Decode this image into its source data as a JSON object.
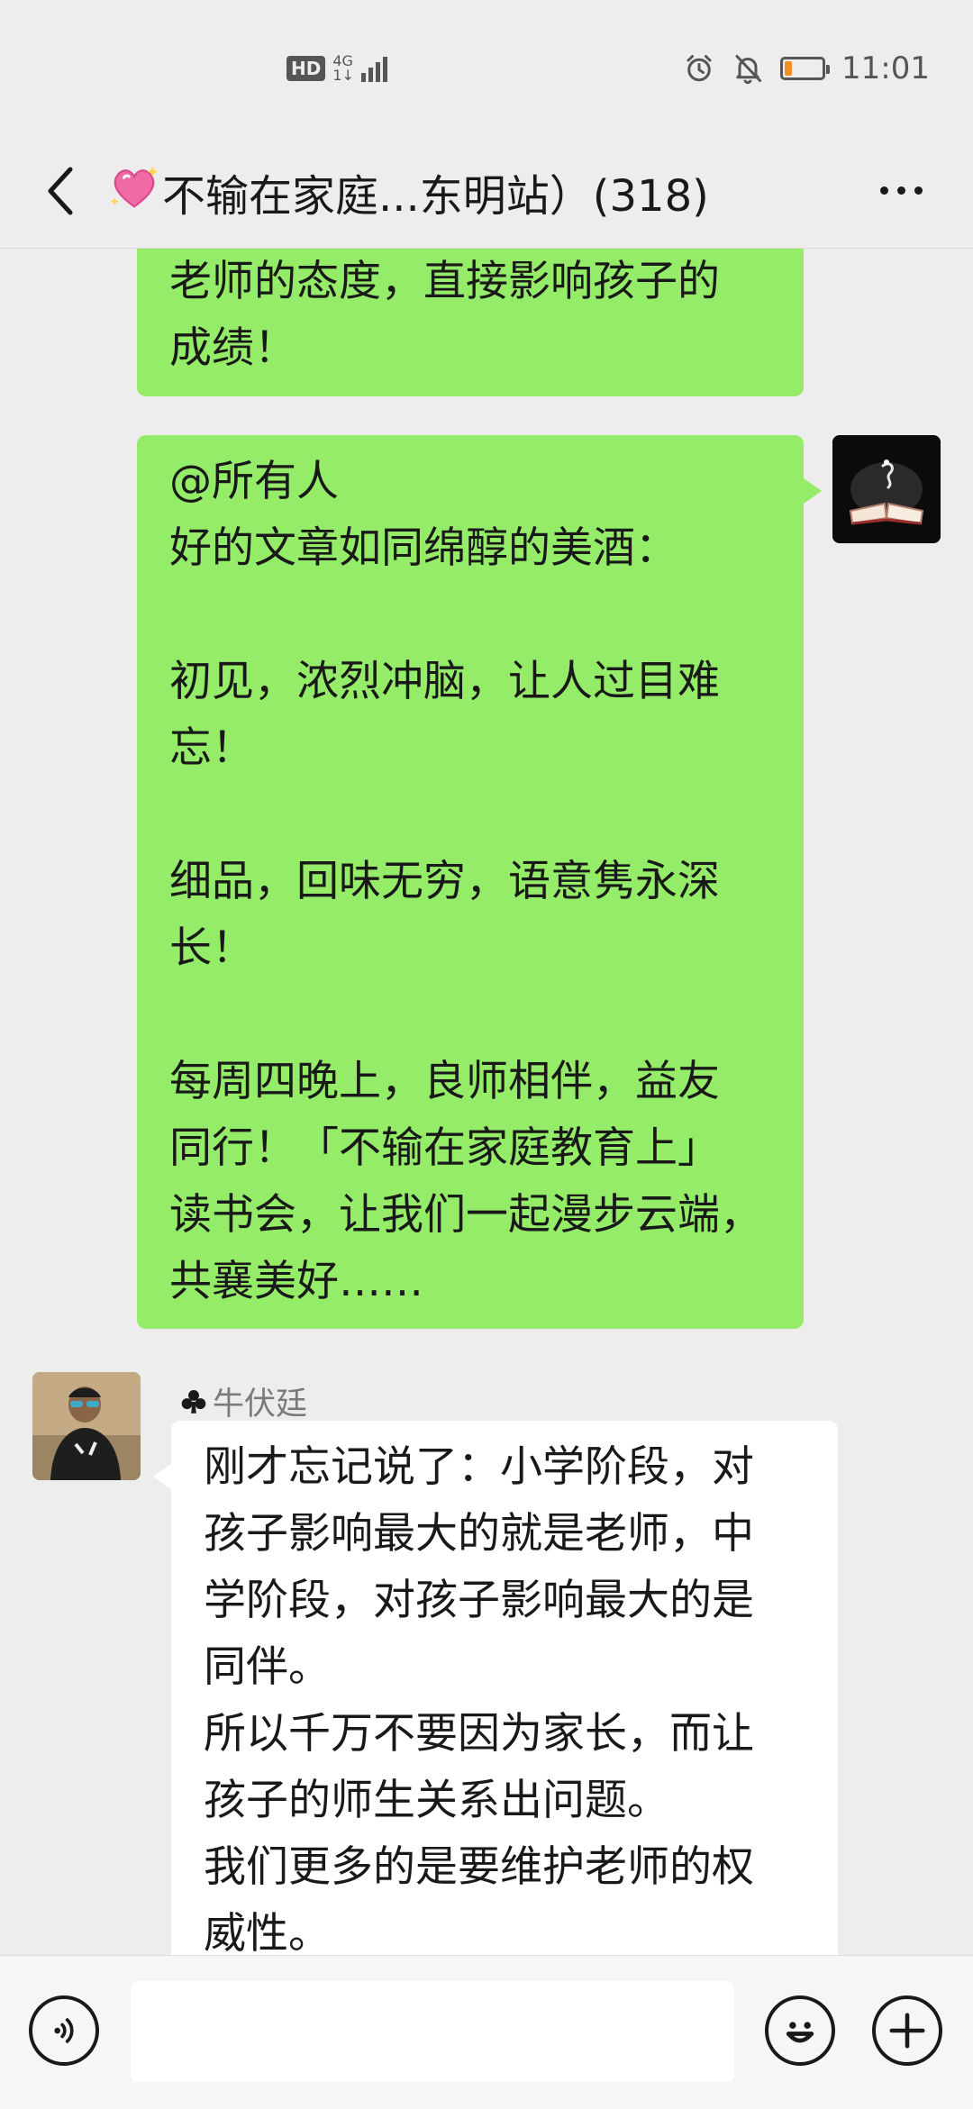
{
  "status_bar": {
    "hd": "HD",
    "network": "4G",
    "network_sub": "1↓",
    "time": "11:01",
    "battery_level": 0.2,
    "icons": [
      "alarm-icon",
      "mute-icon",
      "battery-icon"
    ]
  },
  "nav": {
    "title": "不输在家庭...东明站）(318)",
    "title_icon": "sparkling-heart-icon",
    "back_icon": "chevron-left-icon",
    "more_icon": "more-dots-icon"
  },
  "messages": [
    {
      "side": "right",
      "text": "老师的态度，直接影响孩子的\n成绩！"
    },
    {
      "side": "right",
      "avatar": "book-avatar",
      "text": "@所有人\n好的文章如同绵醇的美酒：\n\n初见，浓烈冲脑，让人过目难\n忘！\n\n细品，回味无穷，语意隽永深\n长！\n\n每周四晚上，良师相伴，益友\n同行！「不输在家庭教育上」\n读书会，让我们一起漫步云端，\n共襄美好……"
    },
    {
      "side": "left",
      "sender": "牛伏廷",
      "sender_icon": "club-suit-icon",
      "avatar": "person-avatar",
      "text": "刚才忘记说了：小学阶段，对\n孩子影响最大的就是老师，中\n学阶段，对孩子影响最大的是\n同伴。\n所以千万不要因为家长，而让\n孩子的师生关系出问题。\n我们更多的是要维护老师的权\n威性。"
    }
  ],
  "input_bar": {
    "voice_icon": "voice-icon",
    "emoji_icon": "emoji-icon",
    "plus_icon": "plus-icon",
    "input_value": ""
  },
  "colors": {
    "background": "#ededed",
    "my_bubble": "#95ec69",
    "other_bubble": "#ffffff",
    "battery_low": "#f58d20"
  }
}
